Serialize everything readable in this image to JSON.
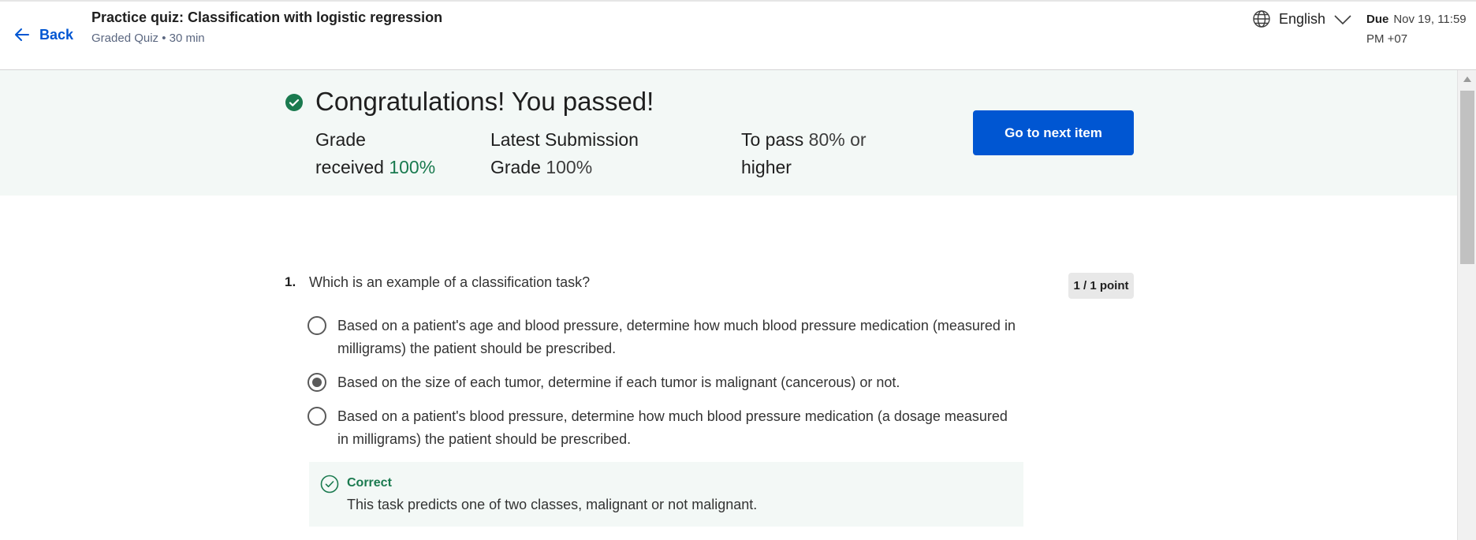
{
  "header": {
    "back_label": "Back",
    "title": "Practice quiz: Classification with logistic regression",
    "subtitle": "Graded Quiz • 30 min",
    "language": "English",
    "due_label": "Due",
    "due_value": "Nov 19, 11:59 PM +07"
  },
  "banner": {
    "message": "Congratulations! You passed!",
    "grade_label_1": "Grade",
    "grade_label_2": "received",
    "grade_value": "100%",
    "latest_label_1": "Latest Submission",
    "latest_label_2": "Grade",
    "latest_value": "100%",
    "pass_label": "To pass",
    "pass_value": "80%",
    "pass_suffix_1": "or",
    "pass_suffix_2": "higher",
    "next_button": "Go to next item"
  },
  "question": {
    "number": "1.",
    "text": "Which is an example of a classification task?",
    "points": "1 / 1 point",
    "options": [
      {
        "text": "Based on a patient's age and blood pressure, determine how much blood pressure medication (measured in milligrams) the patient should be prescribed.",
        "selected": false
      },
      {
        "text": "Based on the size of each tumor, determine if each tumor is malignant (cancerous) or not.",
        "selected": true
      },
      {
        "text": "Based on a patient's blood pressure, determine how much blood pressure medication (a dosage measured in milligrams) the patient should be prescribed.",
        "selected": false
      }
    ],
    "feedback": {
      "title": "Correct",
      "text": "This task predicts one of two classes, malignant or not malignant."
    }
  },
  "colors": {
    "accent": "#0056d2",
    "success": "#1a7a4f",
    "banner_bg": "#f3f8f6"
  },
  "icons": {
    "back": "arrow-left-icon",
    "language": "globe-icon",
    "dropdown": "chevron-down-icon",
    "passed": "check-circle-icon",
    "feedback": "check-circle-outline-icon"
  }
}
